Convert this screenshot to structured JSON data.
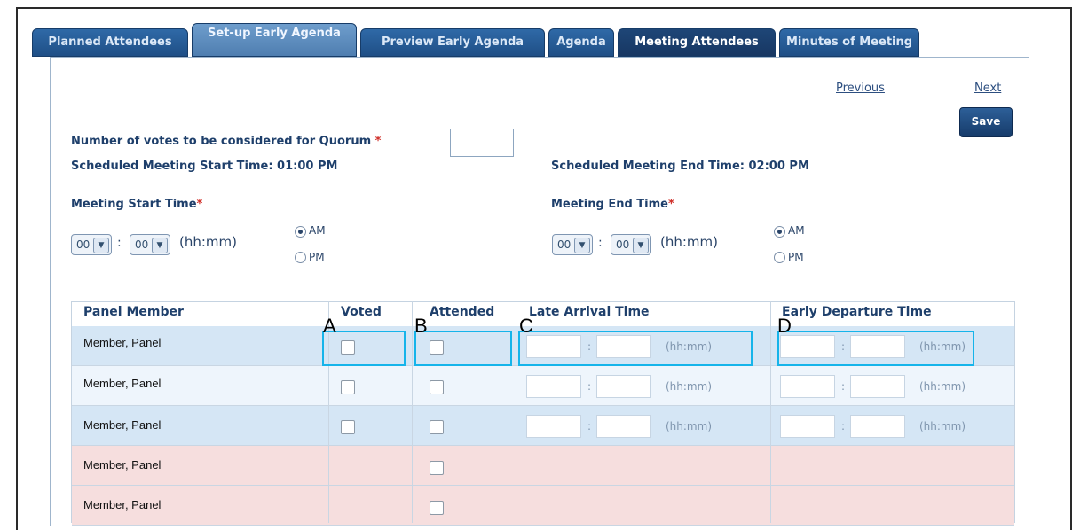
{
  "tabs": [
    {
      "label": "Planned Attendees"
    },
    {
      "label": "Set-up Early Agenda"
    },
    {
      "label": "Preview Early Agenda"
    },
    {
      "label": "Agenda"
    },
    {
      "label": "Meeting Attendees"
    },
    {
      "label": "Minutes of Meeting"
    }
  ],
  "nav": {
    "previous": "Previous",
    "next": "Next",
    "save": "Save"
  },
  "quorum": {
    "label": "Number of votes to be considered for Quorum",
    "required": "*",
    "value": ""
  },
  "scheduled": {
    "start": "Scheduled Meeting Start Time: 01:00 PM",
    "end": "Scheduled Meeting End Time: 02:00 PM"
  },
  "meeting_start": {
    "label": "Meeting Start Time",
    "required": "*",
    "hour": "00",
    "minute": "00",
    "hint": "(hh:mm)",
    "am": "AM",
    "pm": "PM",
    "selected": "AM"
  },
  "meeting_end": {
    "label": "Meeting End Time",
    "required": "*",
    "hour": "00",
    "minute": "00",
    "hint": "(hh:mm)",
    "am": "AM",
    "pm": "PM",
    "selected": "AM"
  },
  "table": {
    "headers": [
      "Panel Member",
      "Voted",
      "Attended",
      "Late Arrival Time",
      "Early Departure Time"
    ],
    "time_colon": ":",
    "time_hint": "(hh:mm)",
    "rows": [
      {
        "name": "Member, Panel"
      },
      {
        "name": "Member, Panel"
      },
      {
        "name": "Member, Panel"
      },
      {
        "name": "Member, Panel"
      },
      {
        "name": "Member, Panel"
      }
    ]
  },
  "annotations": [
    "A",
    "B",
    "C",
    "D"
  ],
  "colors": {
    "tab_dark": "#1e4677",
    "tab_active": "#5f8ebf",
    "row_blue": "#d5e6f5",
    "row_light": "#eef5fc",
    "row_pink": "#f6dede",
    "highlight": "#16b4ea"
  }
}
